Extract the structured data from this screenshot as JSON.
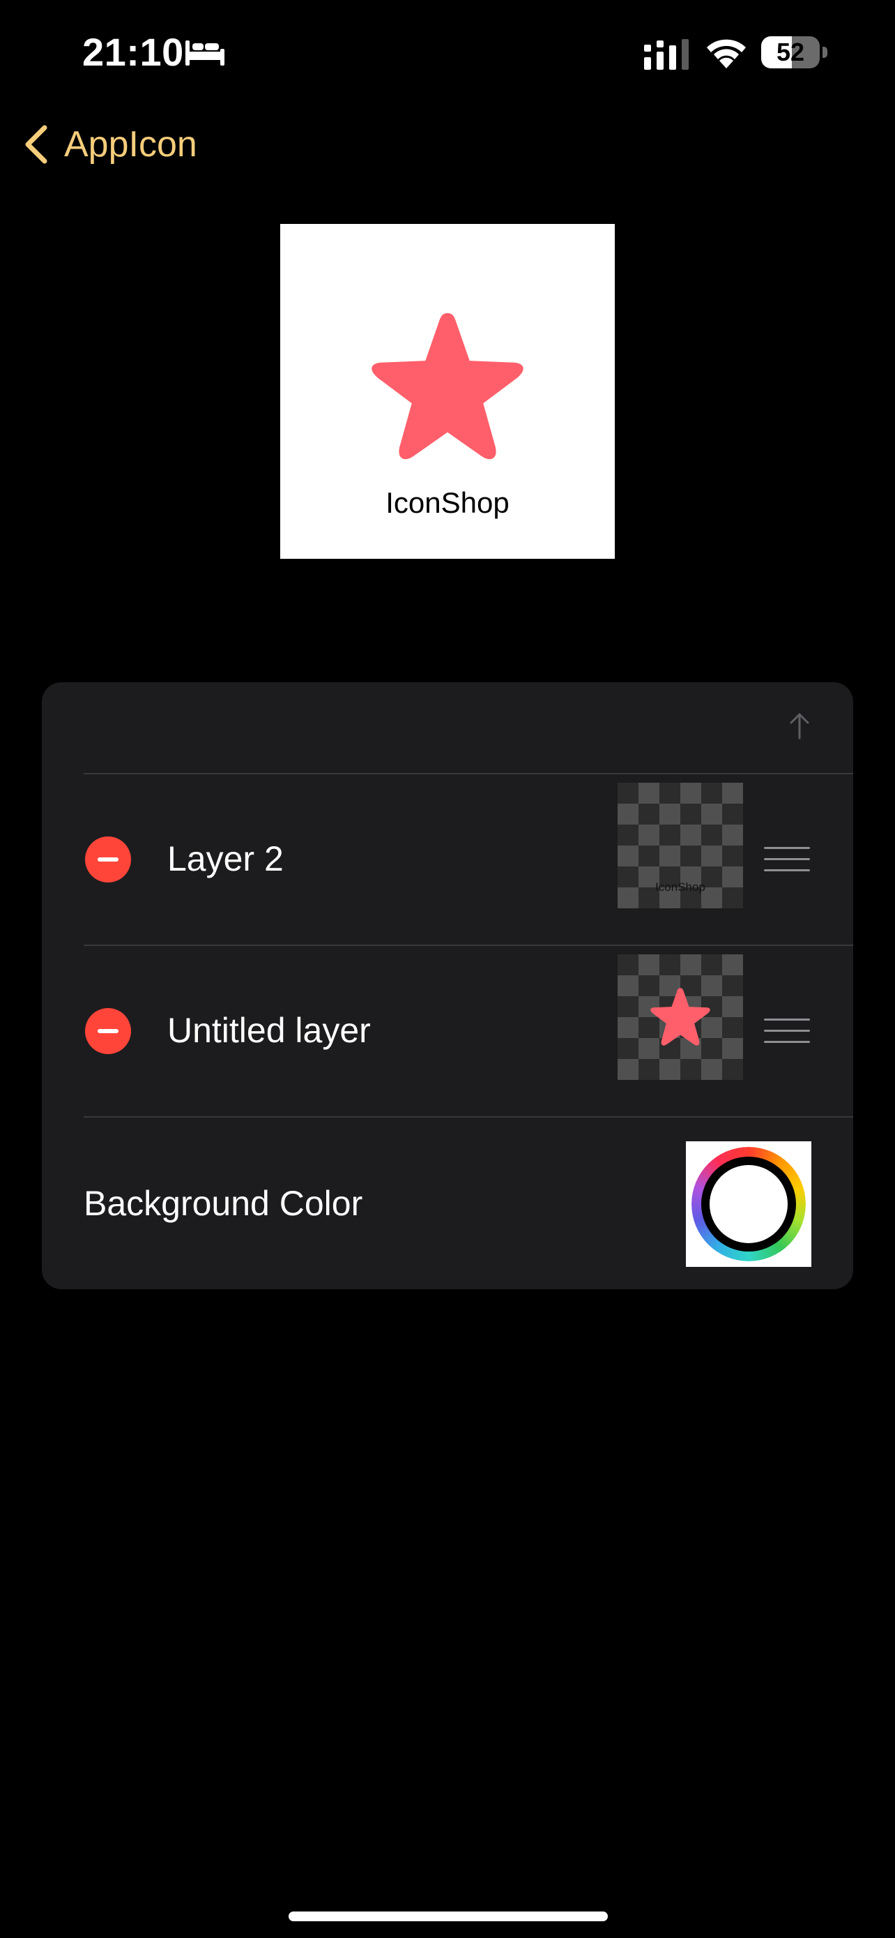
{
  "status_bar": {
    "time": "21:10",
    "battery_level": "52",
    "battery_fraction": 0.52,
    "icons": [
      "sleep-icon",
      "cellular-signal-icon",
      "wifi-icon",
      "battery-icon"
    ]
  },
  "nav": {
    "back_label": "AppIcon",
    "back_icon": "chevron-left-icon"
  },
  "preview": {
    "text": "IconShop",
    "icon": "star-icon"
  },
  "layers": {
    "header_icon": "arrow-up-icon",
    "items": [
      {
        "name": "Layer 2",
        "thumbnail_text": "IconShop",
        "thumbnail_type": "text"
      },
      {
        "name": "Untitled layer",
        "thumbnail_type": "star"
      }
    ],
    "background_label": "Background Color"
  },
  "colors": {
    "accent": "#f6cd7b",
    "delete": "#ff453a",
    "star": "#fe5f6a",
    "card": "#1c1c1e",
    "background": "#000000",
    "divider": "#38383a"
  }
}
